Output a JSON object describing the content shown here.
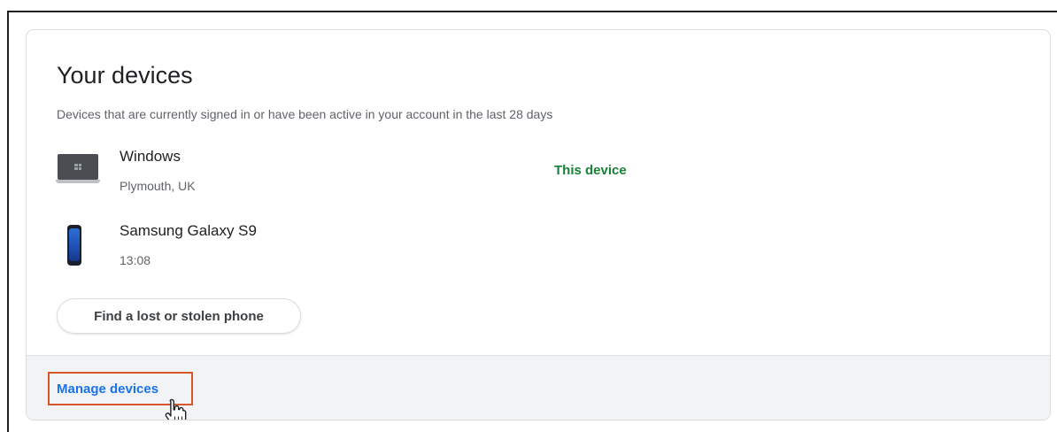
{
  "card": {
    "title": "Your devices",
    "subtitle": "Devices that are currently signed in or have been active in your account in the last 28 days"
  },
  "devices": [
    {
      "name": "Windows",
      "meta": "Plymouth, UK",
      "status": "This device",
      "icon": "laptop-icon"
    },
    {
      "name": "Samsung Galaxy S9",
      "meta": "13:08",
      "status": "",
      "icon": "phone-icon"
    }
  ],
  "actions": {
    "find_phone_label": "Find a lost or stolen phone"
  },
  "footer": {
    "manage_label": "Manage devices"
  },
  "colors": {
    "accent_link": "#1a73e8",
    "status_green": "#188038",
    "highlight_border": "#d9572c"
  }
}
